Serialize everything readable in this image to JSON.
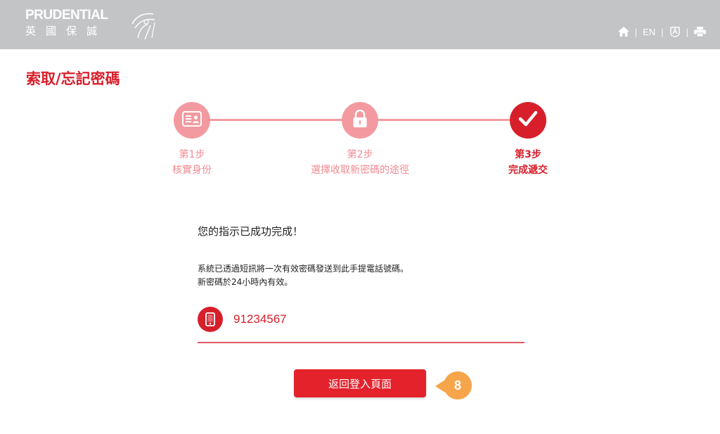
{
  "header": {
    "logo_en": "PRUDENTIAL",
    "logo_zh": "英國保誠",
    "lang_label": "EN",
    "bg_color": "#c3c4c6"
  },
  "page": {
    "title": "索取/忘記密碼",
    "accent_color": "#d71f2b"
  },
  "steps": [
    {
      "num": "第1步",
      "label": "核實身份",
      "icon": "id-card-icon",
      "state": "done"
    },
    {
      "num": "第2步",
      "label": "選擇收取新密碼的途徑",
      "icon": "lock-icon",
      "state": "done"
    },
    {
      "num": "第3步",
      "label": "完成遞交",
      "icon": "checkmark-icon",
      "state": "active"
    }
  ],
  "content": {
    "success_message": "您的指示已成功完成！",
    "sms_line1": "系統已透過短訊將一次有效密碼發送到此手提電話號碼。",
    "sms_line2": "新密碼於24小時內有效。",
    "phone_number": "91234567",
    "phone_icon": "mobile-phone-icon"
  },
  "actions": {
    "back_button_label": "返回登入頁面"
  },
  "annotation": {
    "badge_number": "8",
    "color": "#f6a54b"
  }
}
